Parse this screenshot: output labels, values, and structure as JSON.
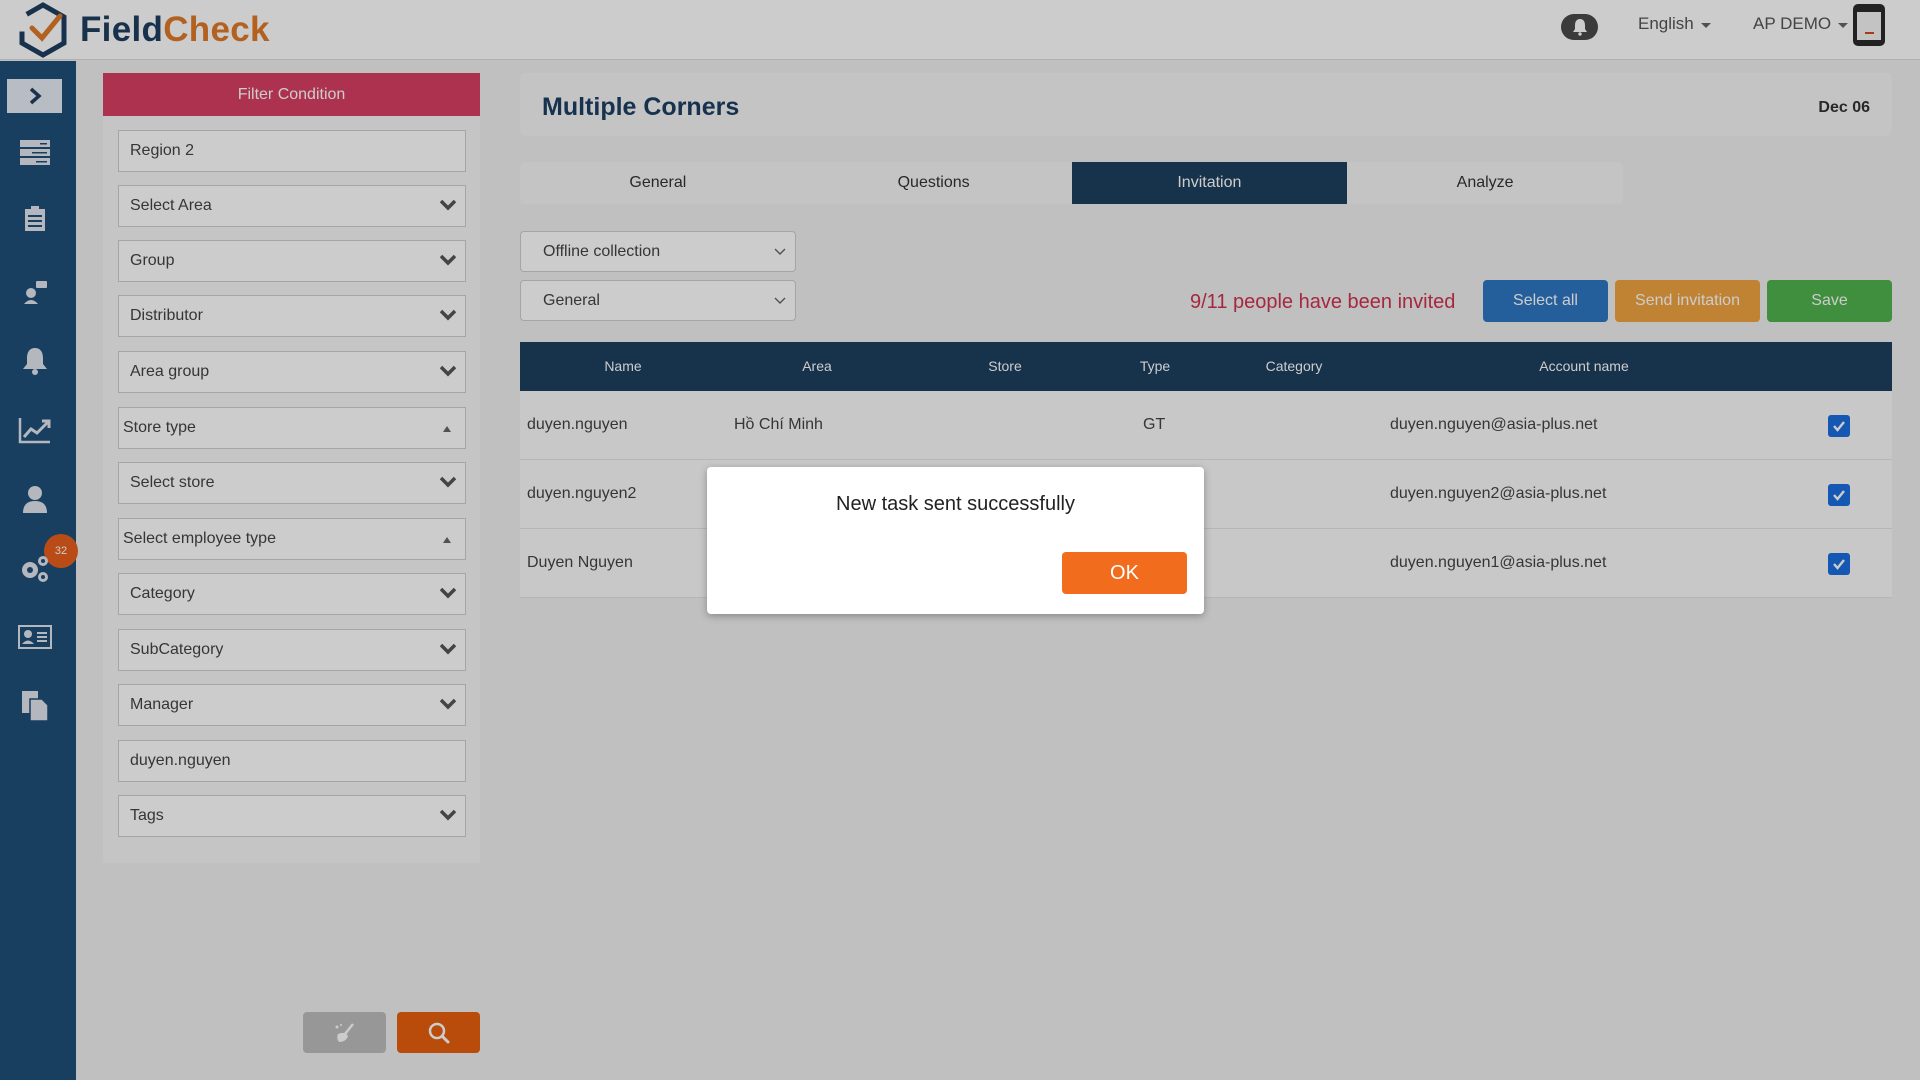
{
  "app": {
    "logo_part1": "Field",
    "logo_part2": "Check"
  },
  "header": {
    "language": "English",
    "user": "AP DEMO",
    "notification_icon": "bell-icon"
  },
  "sidebar": {
    "toggle_icon": "chevron-right-icon",
    "items": [
      {
        "icon": "list-icon"
      },
      {
        "icon": "clipboard-icon"
      },
      {
        "icon": "support-agent-icon"
      },
      {
        "icon": "bell-icon"
      },
      {
        "icon": "line-chart-icon"
      },
      {
        "icon": "user-icon",
        "badge": "32"
      },
      {
        "icon": "gears-icon"
      },
      {
        "icon": "id-card-icon"
      },
      {
        "icon": "documents-icon"
      }
    ]
  },
  "filter": {
    "title": "Filter Condition",
    "fields": [
      {
        "label": "Region 2",
        "kind": "text"
      },
      {
        "label": "Select Area",
        "kind": "dropdown"
      },
      {
        "label": "Group",
        "kind": "dropdown"
      },
      {
        "label": "Distributor",
        "kind": "dropdown"
      },
      {
        "label": "Area group",
        "kind": "dropdown"
      },
      {
        "label": "Store type",
        "kind": "multiselect"
      },
      {
        "label": "Select store",
        "kind": "dropdown"
      },
      {
        "label": "Select employee type",
        "kind": "multiselect"
      },
      {
        "label": "Category",
        "kind": "dropdown"
      },
      {
        "label": "SubCategory",
        "kind": "dropdown"
      },
      {
        "label": "Manager",
        "kind": "dropdown"
      },
      {
        "label": "duyen.nguyen",
        "kind": "text"
      },
      {
        "label": "Tags",
        "kind": "dropdown"
      }
    ],
    "clear_icon": "broom-icon",
    "search_icon": "search-icon"
  },
  "main": {
    "title": "Multiple Corners",
    "date": "Dec 06",
    "tabs": [
      {
        "label": "General",
        "active": false
      },
      {
        "label": "Questions",
        "active": false
      },
      {
        "label": "Invitation",
        "active": true
      },
      {
        "label": "Analyze",
        "active": false
      }
    ],
    "collection_select": "Offline collection",
    "group_select": "General",
    "invited_status": "9/11 people have been invited",
    "buttons": {
      "select_all": "Select all",
      "send_invitation": "Send invitation",
      "save": "Save"
    },
    "table": {
      "columns": [
        "Name",
        "Area",
        "Store",
        "Type",
        "Category",
        "Account name"
      ],
      "rows": [
        {
          "name": "duyen.nguyen",
          "area": "Hồ Chí Minh",
          "store": "",
          "type": "GT",
          "category": "",
          "account": "duyen.nguyen@asia-plus.net",
          "checked": true
        },
        {
          "name": "duyen.nguyen2",
          "area": "",
          "store": "",
          "type": "",
          "category": "",
          "account": "duyen.nguyen2@asia-plus.net",
          "checked": true
        },
        {
          "name": "Duyen Nguyen",
          "area": "",
          "store": "",
          "type": "",
          "category": "",
          "account": "duyen.nguyen1@asia-plus.net",
          "checked": true
        }
      ]
    }
  },
  "modal": {
    "message": "New task sent successfully",
    "ok_label": "OK"
  },
  "colors": {
    "brand_navy": "#1d3f5e",
    "brand_orange": "#e8600e",
    "filter_header": "#d93f63",
    "invited_text": "#d0324f",
    "select_all": "#2e77c4",
    "send_invitation": "#f0a440",
    "save": "#4fb34f"
  }
}
